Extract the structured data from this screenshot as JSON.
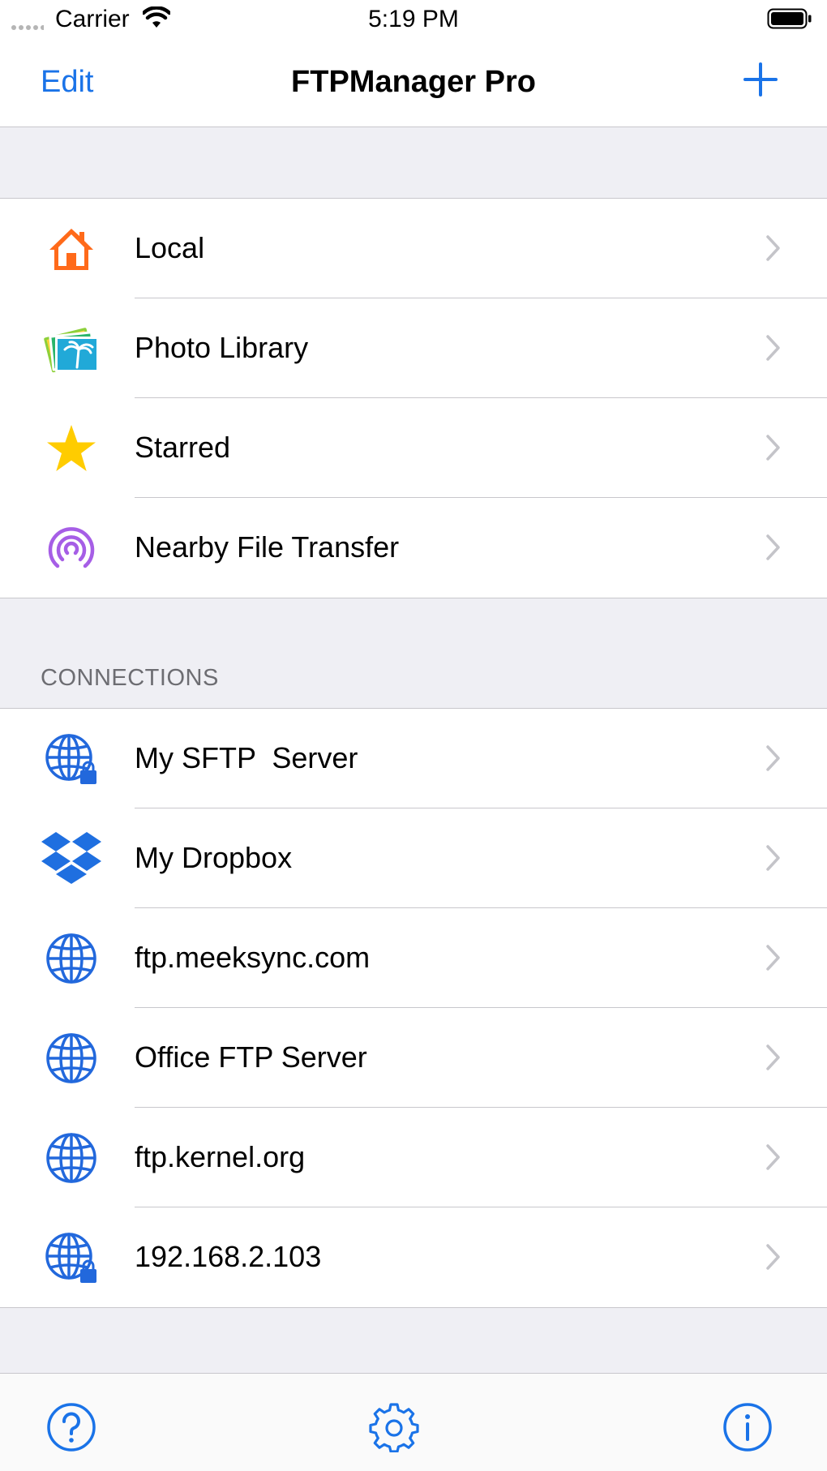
{
  "status_bar": {
    "carrier": "Carrier",
    "time": "5:19 PM"
  },
  "nav": {
    "edit_label": "Edit",
    "title": "FTPManager Pro",
    "add_icon": "plus-icon"
  },
  "locations": [
    {
      "label": "Local",
      "icon": "house-icon"
    },
    {
      "label": "Photo Library",
      "icon": "photos-icon"
    },
    {
      "label": "Starred",
      "icon": "star-icon"
    },
    {
      "label": "Nearby File Transfer",
      "icon": "airdrop-icon"
    }
  ],
  "connections": {
    "header": "CONNECTIONS",
    "items": [
      {
        "label": "My SFTP  Server",
        "icon": "globe-lock-icon"
      },
      {
        "label": "My Dropbox",
        "icon": "dropbox-icon"
      },
      {
        "label": "ftp.meeksync.com",
        "icon": "globe-icon"
      },
      {
        "label": "Office FTP Server",
        "icon": "globe-icon"
      },
      {
        "label": "ftp.kernel.org",
        "icon": "globe-icon"
      },
      {
        "label": "192.168.2.103",
        "icon": "globe-lock-icon"
      }
    ]
  },
  "tab_bar": {
    "help_icon": "help-icon",
    "settings_icon": "gear-icon",
    "info_icon": "info-icon"
  },
  "colors": {
    "accent": "#1a73e8",
    "house": "#ff6a1a",
    "star": "#ffcc00",
    "airdrop": "#a65ee6",
    "separator": "#c8c7cc",
    "background": "#efeff4"
  }
}
